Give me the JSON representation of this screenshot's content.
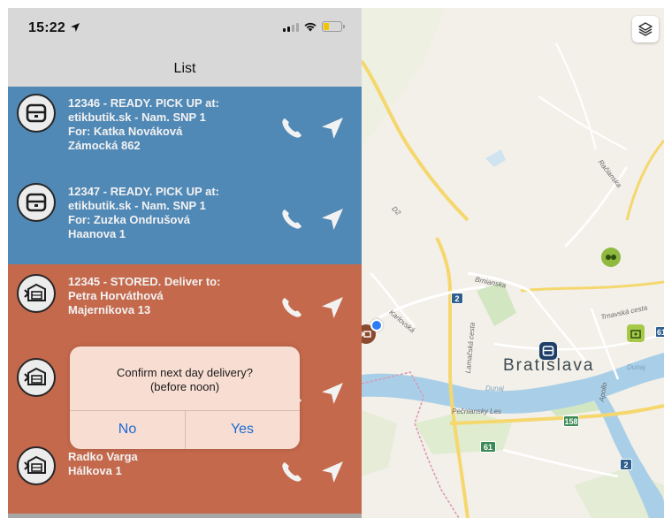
{
  "status_bar": {
    "time": "15:22"
  },
  "nav": {
    "title": "List"
  },
  "list": {
    "items": [
      {
        "status": "ready",
        "icon": "parcel-locker-icon",
        "lines": [
          "12346 - READY. PICK UP at:",
          "etikbutik.sk - Nam. SNP 1",
          "For: Katka Nováková",
          "Zámocká 862"
        ]
      },
      {
        "status": "ready",
        "icon": "parcel-locker-icon",
        "lines": [
          "12347 - READY. PICK UP at:",
          "etikbutik.sk - Nam. SNP 1",
          "For: Zuzka Ondrušová",
          "Haanova 1"
        ]
      },
      {
        "status": "stored",
        "icon": "delivery-box-icon",
        "lines": [
          "12345 - STORED. Deliver to:",
          "Petra Horváthová",
          "Majerníkova 13"
        ]
      },
      {
        "status": "stored",
        "icon": "delivery-box-icon",
        "lines": []
      },
      {
        "status": "stored",
        "icon": "delivery-box-icon",
        "lines": [
          "Radko Varga",
          "Hálkova 1"
        ]
      }
    ]
  },
  "dialog": {
    "message_line1": "Confirm next day delivery?",
    "message_line2": "(before noon)",
    "no_label": "No",
    "yes_label": "Yes"
  },
  "map": {
    "city_label": "Bratislava",
    "street_labels": {
      "brnianska": "Brnianska",
      "karlovska": "Karlovská",
      "lamacska": "Lamačská cesta",
      "racianska": "Račianska",
      "trnavska": "Trnavská cesta",
      "dunaj": "Dunaj",
      "dunaj2": "Dunaj",
      "petrzalka": "Pečniansky Les",
      "apollo": "Apollo",
      "d2": "D2"
    },
    "road_shields": {
      "r2a": "2",
      "r2b": "2",
      "r61": "61",
      "r158": "158",
      "r61b": "61"
    }
  },
  "colors": {
    "ready_row": "#5189b6",
    "stored_row": "#c4694c",
    "dialog_button": "#1b6bd6"
  }
}
